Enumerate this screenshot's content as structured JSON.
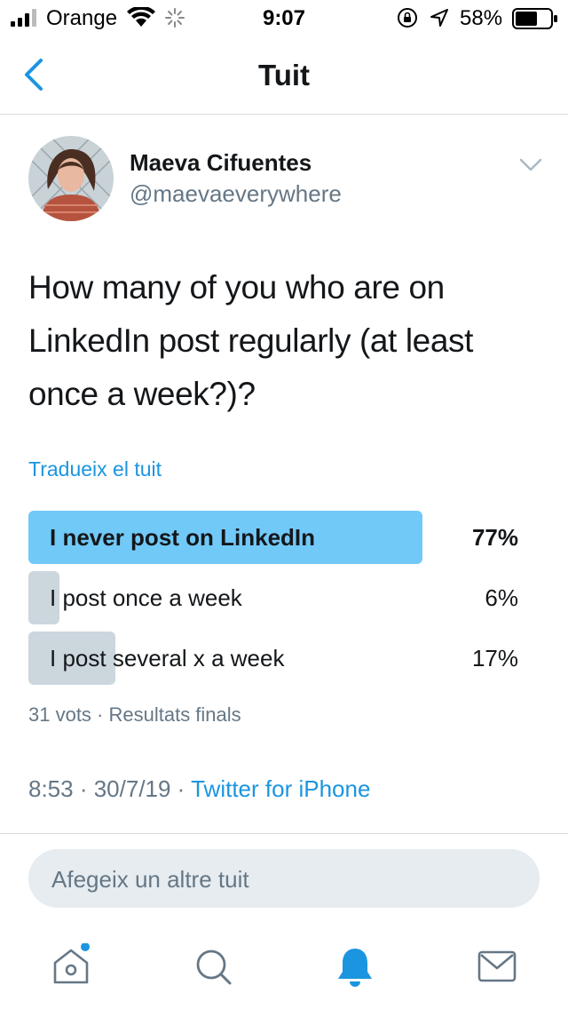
{
  "status_bar": {
    "carrier": "Orange",
    "time": "9:07",
    "battery": "58%"
  },
  "nav": {
    "title": "Tuit"
  },
  "author": {
    "name": "Maeva Cifuentes",
    "handle": "@maevaeverywhere"
  },
  "tweet": {
    "text": "How many of you who are on LinkedIn post regularly (at least once a week?)?",
    "translate_label": "Tradueix el tuit",
    "time": "8:53 · 30/7/19 · ",
    "source": "Twitter for iPhone"
  },
  "poll": {
    "options": [
      {
        "label": "I never post on LinkedIn",
        "percent_text": "77%",
        "fraction": 0.77,
        "winner": true
      },
      {
        "label": "I post once a week",
        "percent_text": "6%",
        "fraction": 0.06,
        "winner": false
      },
      {
        "label": "I post several x a week",
        "percent_text": "17%",
        "fraction": 0.17,
        "winner": false
      }
    ],
    "meta": "31 vots · Resultats finals"
  },
  "reply": {
    "placeholder": "Afegeix un altre tuit"
  },
  "colors": {
    "accent": "#1b95e0",
    "winner_bar": "#71c9f8",
    "other_bar": "#ccd6dd"
  },
  "tabs": [
    {
      "name": "home",
      "icon": "home-icon",
      "has_dot": true
    },
    {
      "name": "search",
      "icon": "search-icon"
    },
    {
      "name": "notifications",
      "icon": "bell-icon",
      "active": true
    },
    {
      "name": "messages",
      "icon": "mail-icon"
    }
  ]
}
